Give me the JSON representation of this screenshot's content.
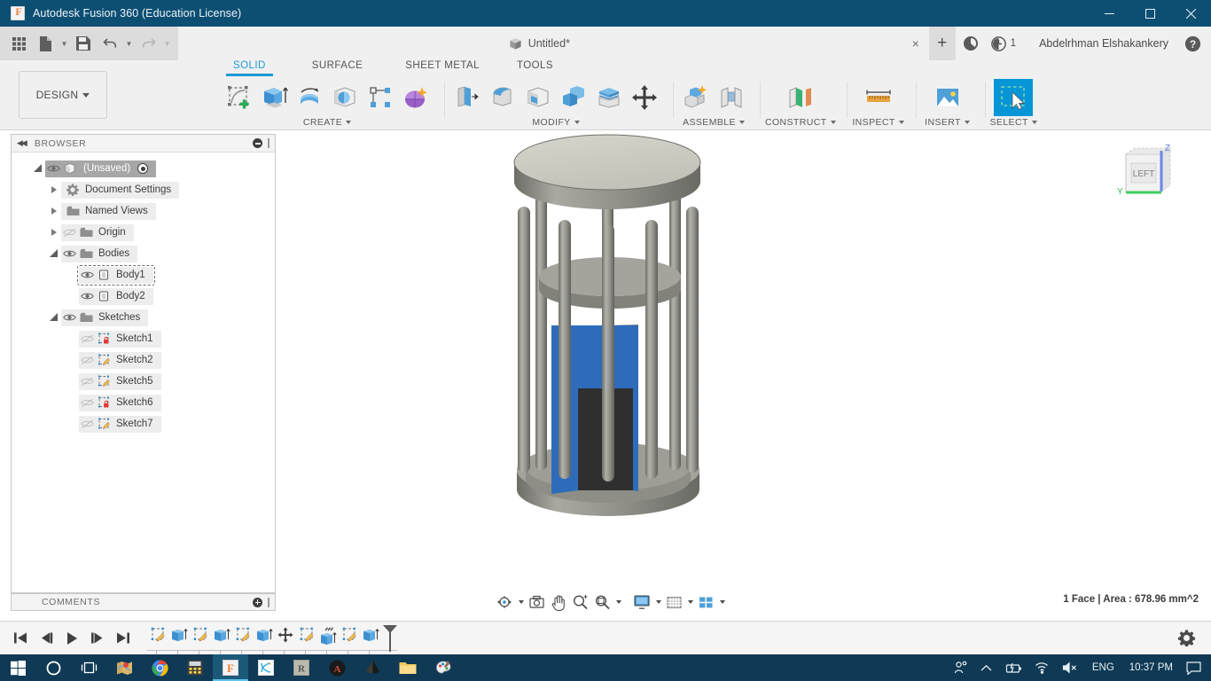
{
  "window": {
    "title": "Autodesk Fusion 360 (Education License)",
    "app_icon": "fusion-logo-icon",
    "minimize": "minimize-icon",
    "maximize": "maximize-icon",
    "close": "close-icon"
  },
  "quick_access": {
    "grid_label": "app-grid-icon",
    "new_label": "new-document-icon",
    "save_label": "save-icon",
    "undo_label": "undo-icon",
    "redo_label": "redo-icon",
    "document_tab": "Untitled*",
    "close_tab": "×",
    "new_tab": "+",
    "job_status_icon": "job-status-icon",
    "notification_icon": "notification-clock-icon",
    "job_count": "1",
    "user_name": "Abdelrhman Elshakankery",
    "help_icon": "help-icon"
  },
  "ribbon": {
    "workspace": "DESIGN",
    "tabs": [
      {
        "label": "SOLID",
        "active": true
      },
      {
        "label": "SURFACE",
        "active": false
      },
      {
        "label": "SHEET METAL",
        "active": false
      },
      {
        "label": "TOOLS",
        "active": false
      }
    ],
    "panels": [
      {
        "label": "CREATE",
        "has_caret": true,
        "tools": [
          "create-sketch-icon",
          "extrude-icon",
          "revolve-icon",
          "sphere-icon",
          "pattern-icon",
          "form-icon"
        ]
      },
      {
        "label": "MODIFY",
        "has_caret": true,
        "tools": [
          "press-pull-icon",
          "fillet-icon",
          "shell-icon",
          "combine-icon",
          "split-face-icon",
          "move-copy-icon"
        ]
      },
      {
        "label": "ASSEMBLE",
        "has_caret": true,
        "tools": [
          "new-component-icon",
          "joint-icon"
        ]
      },
      {
        "label": "CONSTRUCT",
        "has_caret": true,
        "tools": [
          "offset-plane-icon"
        ]
      },
      {
        "label": "INSPECT",
        "has_caret": true,
        "tools": [
          "measure-icon"
        ]
      },
      {
        "label": "INSERT",
        "has_caret": true,
        "tools": [
          "insert-image-icon"
        ]
      },
      {
        "label": "SELECT",
        "has_caret": true,
        "tools": [
          "select-arrow-icon"
        ]
      }
    ]
  },
  "browser": {
    "title": "BROWSER",
    "collapse_icon": "collapse-left-icon",
    "options_icon": "panel-options-icon",
    "tree": [
      {
        "label": "(Unsaved)",
        "level": 0,
        "twisty": "open",
        "eye": "on",
        "icon": "component-icon",
        "radio": true,
        "root": true
      },
      {
        "label": "Document Settings",
        "level": 1,
        "twisty": "closed",
        "eye": "none",
        "icon": "gear-icon"
      },
      {
        "label": "Named Views",
        "level": 1,
        "twisty": "closed",
        "eye": "none",
        "icon": "folder-icon"
      },
      {
        "label": "Origin",
        "level": 1,
        "twisty": "closed",
        "eye": "off",
        "icon": "folder-icon"
      },
      {
        "label": "Bodies",
        "level": 1,
        "twisty": "open",
        "eye": "on",
        "icon": "folder-icon"
      },
      {
        "label": "Body1",
        "level": 2,
        "twisty": "none",
        "eye": "on",
        "icon": "body-icon",
        "selected": true
      },
      {
        "label": "Body2",
        "level": 2,
        "twisty": "none",
        "eye": "on",
        "icon": "body-icon"
      },
      {
        "label": "Sketches",
        "level": 1,
        "twisty": "open",
        "eye": "on",
        "icon": "folder-icon"
      },
      {
        "label": "Sketch1",
        "level": 2,
        "twisty": "none",
        "eye": "off",
        "icon": "sketch-locked-icon"
      },
      {
        "label": "Sketch2",
        "level": 2,
        "twisty": "none",
        "eye": "off",
        "icon": "sketch-icon"
      },
      {
        "label": "Sketch5",
        "level": 2,
        "twisty": "none",
        "eye": "off",
        "icon": "sketch-icon"
      },
      {
        "label": "Sketch6",
        "level": 2,
        "twisty": "none",
        "eye": "off",
        "icon": "sketch-locked-icon"
      },
      {
        "label": "Sketch7",
        "level": 2,
        "twisty": "none",
        "eye": "off",
        "icon": "sketch-icon"
      }
    ]
  },
  "comments": {
    "title": "COMMENTS",
    "add_icon": "add-comment-icon"
  },
  "canvas": {
    "viewcube_face": "LEFT",
    "axis_z": "Z",
    "axis_y": "Y",
    "model_description": "grey cylindrical stool/table body with vertical rods and a blue highlighted selected face",
    "colors": {
      "body_grey": "#8d8d88",
      "top_light": "#cfcec5",
      "selected_blue": "#2b6cb8",
      "dark_cavity": "#2f2f2f",
      "background": "#ffffff"
    }
  },
  "navbar": {
    "buttons": [
      {
        "name": "orbit-icon",
        "caret": true
      },
      {
        "name": "look-at-icon",
        "caret": false
      },
      {
        "name": "pan-hand-icon",
        "caret": false
      },
      {
        "name": "zoom-icon",
        "caret": false
      },
      {
        "name": "zoom-window-icon",
        "caret": true
      },
      {
        "name": "display-settings-icon",
        "caret": true
      },
      {
        "name": "grid-snap-icon",
        "caret": true
      },
      {
        "name": "viewports-icon",
        "caret": true
      }
    ]
  },
  "status": {
    "text": "1 Face | Area : 678.96 mm^2"
  },
  "timeline": {
    "playback": [
      "skip-to-start-icon",
      "step-back-icon",
      "play-icon",
      "step-forward-icon",
      "skip-to-end-icon"
    ],
    "features": [
      "sketch-icon",
      "extrude-icon",
      "sketch-icon",
      "extrude-icon",
      "sketch-icon",
      "extrude-icon",
      "move-copy-icon",
      "sketch-icon",
      "extrude-icon",
      "sketch-icon",
      "extrude-icon"
    ],
    "marker": "timeline-marker",
    "settings_icon": "timeline-settings-icon"
  },
  "taskbar": {
    "apps": [
      "windows-start-icon",
      "cortana-search-icon",
      "task-view-icon",
      "maps-icon",
      "chrome-icon",
      "calculator-icon",
      "fusion360-icon",
      "inventor-icon",
      "revit-icon",
      "autocad-icon",
      "inkscape-icon",
      "file-explorer-icon",
      "paint-icon"
    ],
    "active_app": "fusion360-icon",
    "tray": {
      "people_icon": "people-icon",
      "chevron_icon": "show-hidden-icons-icon",
      "battery_icon": "battery-charging-icon",
      "network_icon": "wifi-icon",
      "volume_icon": "volume-muted-icon",
      "language": "ENG",
      "time": "10:37 PM",
      "action_center_icon": "action-center-icon"
    }
  }
}
